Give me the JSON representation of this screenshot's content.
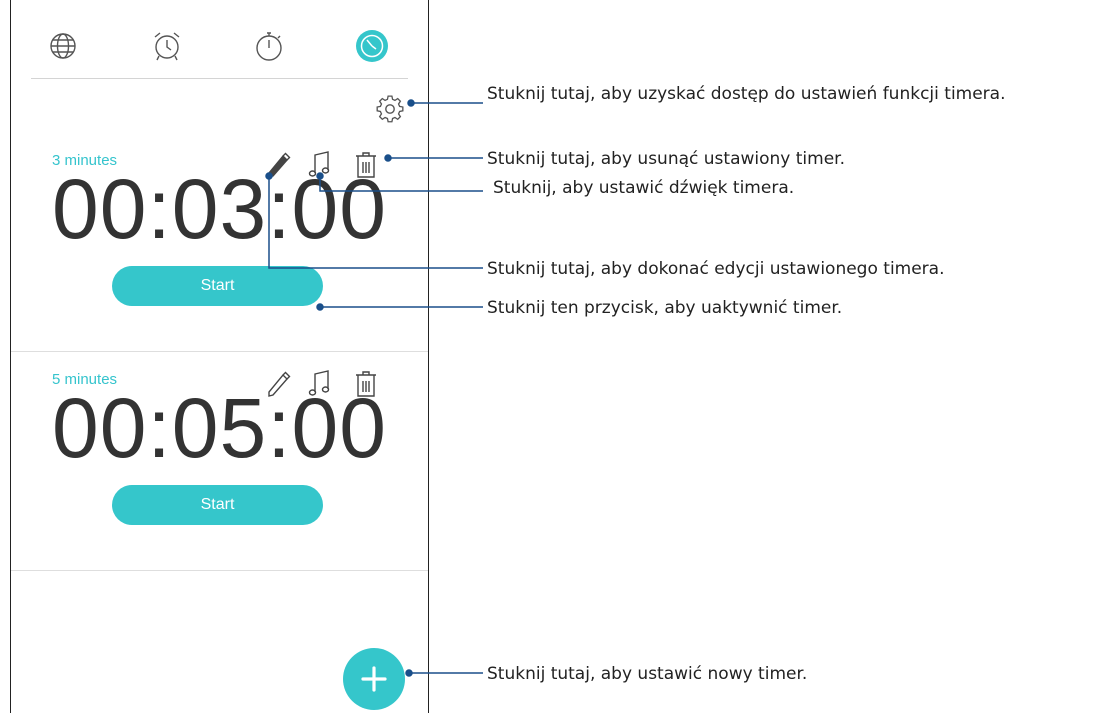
{
  "tabs": [
    {
      "icon": "world-clock-icon"
    },
    {
      "icon": "alarm-clock-icon"
    },
    {
      "icon": "stopwatch-icon"
    },
    {
      "icon": "timer-icon",
      "active": true
    }
  ],
  "colors": {
    "accent": "#35c6cb",
    "label": "#35c4cd",
    "callout_line": "#1a4f8a"
  },
  "timers": [
    {
      "label": "3 minutes",
      "time": "00:03:00",
      "start_label": "Start"
    },
    {
      "label": "5 minutes",
      "time": "00:05:00",
      "start_label": "Start"
    }
  ],
  "card_icons": [
    "pencil-icon",
    "music-note-icon",
    "trash-icon"
  ],
  "fab_icon": "plus-icon",
  "settings_icon": "gear-icon",
  "callouts": {
    "settings": "Stuknij tutaj, aby uzyskać dostęp do ustawień funkcji timera.",
    "delete": "Stuknij tutaj, aby usunąć ustawiony timer.",
    "sound": "Stuknij, aby ustawić dźwięk timera.",
    "edit": "Stuknij tutaj, aby dokonać edycji ustawionego timera.",
    "start": "Stuknij ten przycisk, aby uaktywnić timer.",
    "add": "Stuknij tutaj, aby ustawić nowy timer."
  }
}
